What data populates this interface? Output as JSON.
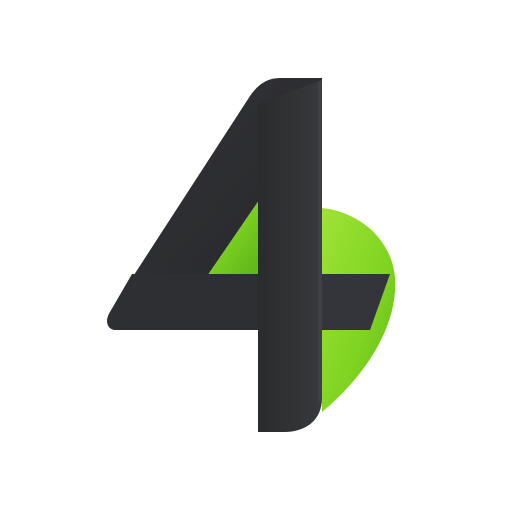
{
  "logo": {
    "name": "four-numeral-logo-icon",
    "glyph": "4",
    "colors": {
      "dark": "#2b2c2e",
      "dark_edge": "#3a3b3e",
      "green": "#7fd321",
      "green_light": "#a4e83a",
      "background": "#ffffff"
    }
  }
}
